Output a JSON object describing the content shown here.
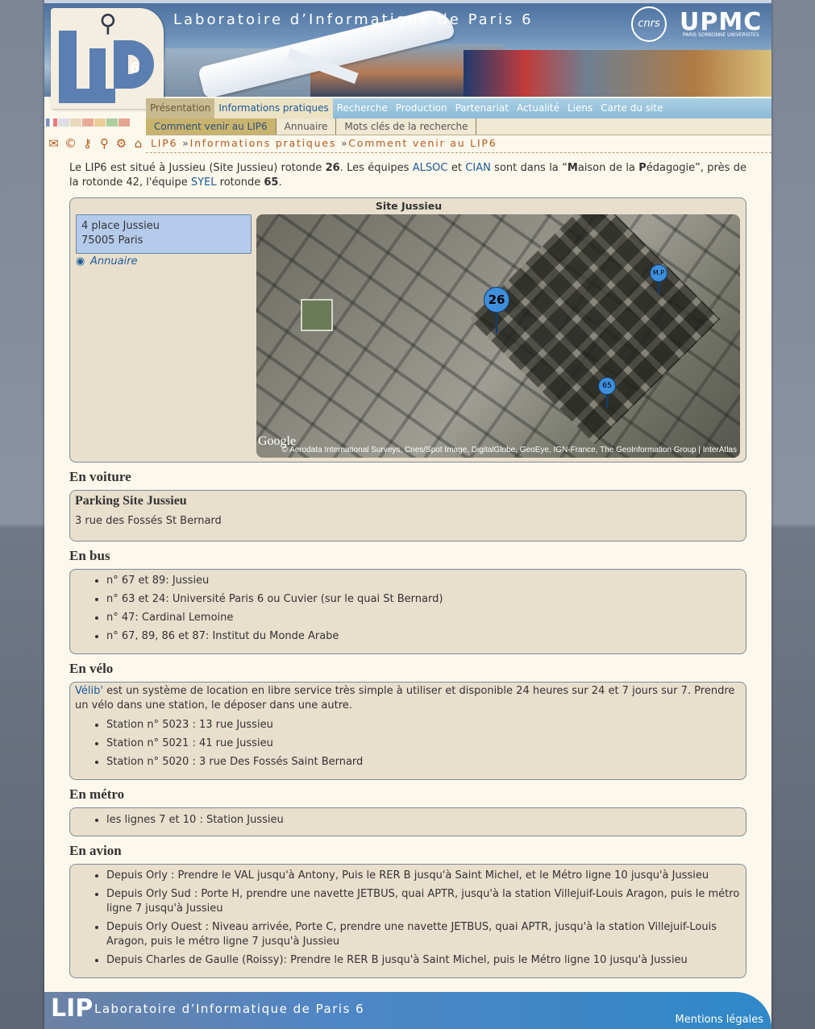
{
  "header": {
    "title": "Laboratoire d’Informatique de Paris 6",
    "logo_text": "LIP6",
    "partner1": "cnrs",
    "partner2": "UPMC",
    "partner2_sub": "PARIS SORBONNE UNIVERSITÉS"
  },
  "nav": {
    "items": [
      {
        "label": "Présentation"
      },
      {
        "label": "Informations pratiques"
      },
      {
        "label": "Recherche"
      },
      {
        "label": "Production"
      },
      {
        "label": "Partenariat"
      },
      {
        "label": "Actualité"
      },
      {
        "label": "Liens"
      },
      {
        "label": "Carte du site"
      }
    ],
    "sub": [
      {
        "label": "Comment venir au LIP6"
      },
      {
        "label": "Annuaire"
      },
      {
        "label": "Mots clés de la recherche"
      }
    ]
  },
  "breadcrumb": {
    "items": [
      "LIP6",
      "Informations pratiques",
      "Comment venir au LIP6"
    ],
    "sep": "»"
  },
  "icons": [
    "mail-icon",
    "copyright-icon",
    "key-icon",
    "search-icon",
    "gear-icon",
    "home-icon"
  ],
  "intro": {
    "t1": "Le LIP6 est situé à Jussieu (Site Jussieu) rotonde ",
    "n1": "26",
    "t2": ". Les équipes ",
    "alsoc": "ALSOC",
    "t3": " et ",
    "cian": "CIAN",
    "t4": " sont dans la “",
    "m": "M",
    "t5": "aison de la ",
    "p": "P",
    "t6": "édagogie”, près de la rotonde 42, l'équipe ",
    "syel": "SYEL",
    "t7": " rotonde ",
    "n2": "65",
    "t8": "."
  },
  "site": {
    "title": "Site Jussieu",
    "address_line1": "4 place Jussieu",
    "address_line2": "75005 Paris",
    "annuaire": "Annuaire",
    "map": {
      "marker_main": "26",
      "marker_mp": "M.P",
      "marker_65": "65",
      "logo": "Google",
      "attribution": "© Aerodata International Surveys, Cnes/Spot Image, DigitalGlobe, GeoEye, IGN-France, The GeoInformation Group | InterAtlas"
    }
  },
  "voiture": {
    "heading": "En voiture",
    "title": "Parking Site Jussieu",
    "address": "3 rue des Fossés St Bernard"
  },
  "bus": {
    "heading": "En bus",
    "items": [
      "n° 67 et 89: Jussieu",
      "n° 63 et 24: Université Paris 6 ou Cuvier (sur le quai St Bernard)",
      "n° 47: Cardinal Lemoine",
      "n° 67, 89, 86 et 87: Institut du Monde Arabe"
    ]
  },
  "velo": {
    "heading": "En vélo",
    "link": "Vélib'",
    "text": " est un système de location en libre service très simple à utiliser et disponible 24 heures sur 24 et 7 jours sur 7. Prendre un vélo dans une station, le déposer dans une autre.",
    "items": [
      "Station n° 5023 : 13 rue Jussieu",
      "Station n° 5021 : 41 rue Jussieu",
      "Station n° 5020 : 3 rue Des Fossés Saint Bernard"
    ]
  },
  "metro": {
    "heading": "En métro",
    "items": [
      "les lignes 7 et 10 : Station Jussieu"
    ]
  },
  "avion": {
    "heading": "En avion",
    "items": [
      "Depuis Orly : Prendre le VAL jusqu'à Antony, Puis le RER B jusqu'à Saint Michel, et le Métro ligne 10 jusqu'à Jussieu",
      "Depuis Orly Sud : Porte H, prendre une navette JETBUS, quai APTR, jusqu'à la station Villejuif-Louis Aragon, puis le métro ligne 7 jusqu'à Jussieu",
      "Depuis Orly Ouest : Niveau arrivée, Porte C, prendre une navette JETBUS, quai APTR, jusqu'à la station Villejuif-Louis Aragon, puis le métro ligne 7 jusqu'à Jussieu",
      "Depuis Charles de Gaulle (Roissy): Prendre le RER B jusqu'à Saint Michel, puis le Métro ligne 10 jusqu'à Jussieu"
    ]
  },
  "footer": {
    "title": "Laboratoire d’Informatique de Paris 6",
    "logo": "LIP",
    "legal": "Mentions légales"
  }
}
